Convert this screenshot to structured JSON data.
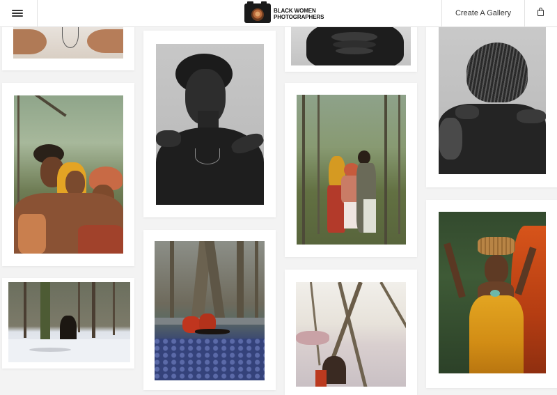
{
  "header": {
    "menu_icon": "hamburger-menu-icon",
    "logo_line1": "BLACK WOMEN",
    "logo_line2": "PHOTOGRAPHERS",
    "logo_icon": "camera-logo-icon",
    "create_gallery": "Create A Gallery",
    "cart_icon": "shopping-bag-icon"
  },
  "gallery": {
    "photos": [
      {
        "subject": "hands-with-necklace",
        "tone": "color"
      },
      {
        "subject": "three-women-with-headwraps",
        "tone": "color"
      },
      {
        "subject": "woman-in-snowy-forest",
        "tone": "color"
      },
      {
        "subject": "woman-portrait-black-and-white",
        "tone": "monochrome"
      },
      {
        "subject": "two-women-in-forest-flowers",
        "tone": "color"
      },
      {
        "subject": "woman-with-neck-rings",
        "tone": "monochrome"
      },
      {
        "subject": "three-women-in-forest",
        "tone": "color"
      },
      {
        "subject": "people-under-branches",
        "tone": "color"
      },
      {
        "subject": "woman-with-braids-back-view",
        "tone": "monochrome"
      },
      {
        "subject": "woman-carrying-basket-yellow-dress",
        "tone": "color"
      }
    ]
  },
  "colors": {
    "background": "#f3f3f3",
    "card": "#ffffff",
    "divider": "#e2e2e2",
    "text": "#333333"
  }
}
